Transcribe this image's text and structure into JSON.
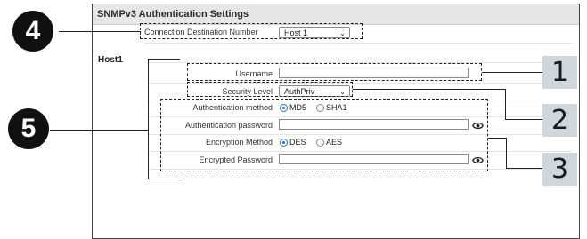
{
  "panel": {
    "title": "SNMPv3 Authentication Settings"
  },
  "connection": {
    "label": "Connection Destination Number",
    "value": "Host 1"
  },
  "host": {
    "section_label": "Host1",
    "username_label": "Username",
    "username_value": "",
    "security_level_label": "Security Level",
    "security_level_value": "AuthPriv",
    "auth_method_label": "Authentication method",
    "auth_method_options": [
      "MD5",
      "SHA1"
    ],
    "auth_method_selected": "MD5",
    "auth_password_label": "Authentication password",
    "auth_password_value": "",
    "enc_method_label": "Encryption Method",
    "enc_method_options": [
      "DES",
      "AES"
    ],
    "enc_method_selected": "DES",
    "enc_password_label": "Encrypted Password",
    "enc_password_value": ""
  },
  "callouts": {
    "circle_4": "4",
    "circle_5": "5",
    "box_1": "1",
    "box_2": "2",
    "box_3": "3"
  },
  "icons": {
    "show_password": "eye-icon",
    "dropdown": "chevron-down-icon"
  },
  "colors": {
    "callout_box": "#cfd6dc",
    "callout_circle": "#111111",
    "radio_selected": "#1f6fd6",
    "header_bg": "#e6e6e6"
  }
}
